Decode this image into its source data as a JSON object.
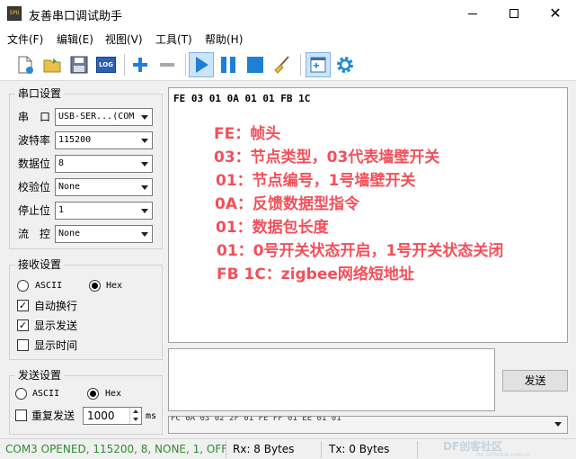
{
  "window": {
    "title": "友善串口调试助手",
    "app_icon_text": "SPU"
  },
  "menu": [
    "文件(F)",
    "编辑(E)",
    "视图(V)",
    "工具(T)",
    "帮助(H)"
  ],
  "toolbar": {
    "log_label": "LOG",
    "icons": [
      "new-file-icon",
      "open-folder-icon",
      "save-icon",
      "log-icon",
      "plus-icon",
      "minus-icon",
      "play-icon",
      "pause-icon",
      "stop-icon",
      "broom-icon",
      "add-window-icon",
      "gear-icon"
    ],
    "accent": "#1e7fd4"
  },
  "serial_settings": {
    "title": "串口设置",
    "fields": [
      {
        "label": "串　口",
        "value": "USB-SER...(COM"
      },
      {
        "label": "波特率",
        "value": "115200"
      },
      {
        "label": "数据位",
        "value": "8"
      },
      {
        "label": "校验位",
        "value": "None"
      },
      {
        "label": "停止位",
        "value": "1"
      },
      {
        "label": "流　控",
        "value": "None"
      }
    ]
  },
  "receive_settings": {
    "title": "接收设置",
    "ascii_label": "ASCII",
    "hex_label": "Hex",
    "selected": "Hex",
    "options": [
      {
        "label": "自动换行",
        "checked": true,
        "mark": "✓"
      },
      {
        "label": "显示发送",
        "checked": true,
        "mark": "✓"
      },
      {
        "label": "显示时间",
        "checked": false,
        "mark": ""
      }
    ]
  },
  "send_settings": {
    "title": "发送设置",
    "ascii_label": "ASCII",
    "hex_label": "Hex",
    "selected": "Hex",
    "repeat_label": "重复发送",
    "repeat_checked": false,
    "interval_value": "1000",
    "interval_unit": "ms"
  },
  "receive_area": {
    "hex_line": "FE 03 01 0A 01 01 FB 1C",
    "annotations": [
      "FE：帧头",
      "03：节点类型，03代表墙壁开关",
      "01：节点编号，1号墙壁开关",
      "0A：反馈数据型指令",
      "01：数据包长度",
      "01：0号开关状态开启，1号开关状态关闭",
      "FB 1C：zigbee网络短地址"
    ],
    "annotation_color": "#f2505a"
  },
  "send_area": {
    "send_button": "发送",
    "history": "FC 0A 03 02 2F 01 FE FF 01 EE 01 01"
  },
  "status_bar": {
    "port_status": "COM3 OPENED, 115200, 8, NONE, 1, OFF",
    "port_status_color": "#2e8b2e",
    "rx": "Rx: 8 Bytes",
    "tx": "Tx: 0 Bytes",
    "watermark": "DF创客社区",
    "watermark_sub": "mc.DFRobot.com.cn"
  }
}
